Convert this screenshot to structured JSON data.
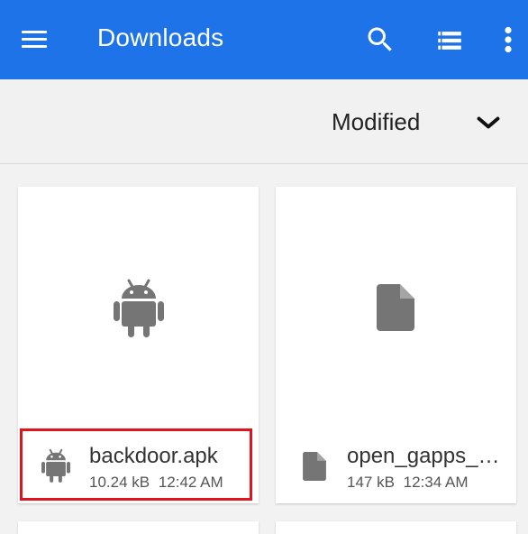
{
  "appbar": {
    "title": "Downloads",
    "menu_icon": "hamburger-menu-icon",
    "search_icon": "search-icon",
    "view_icon": "list-view-icon",
    "more_icon": "more-vert-icon",
    "color": "#1e73e8"
  },
  "sort": {
    "label": "Modified",
    "icon": "chevron-down-icon"
  },
  "files": [
    {
      "name": "backdoor.apk",
      "size": "10.24 kB",
      "time": "12:42 AM",
      "icon": "android-icon",
      "highlighted": true
    },
    {
      "name": "open_gapps_…",
      "size": "147 kB",
      "time": "12:34 AM",
      "icon": "file-icon",
      "highlighted": false
    }
  ],
  "highlight_color": "#e0141e"
}
